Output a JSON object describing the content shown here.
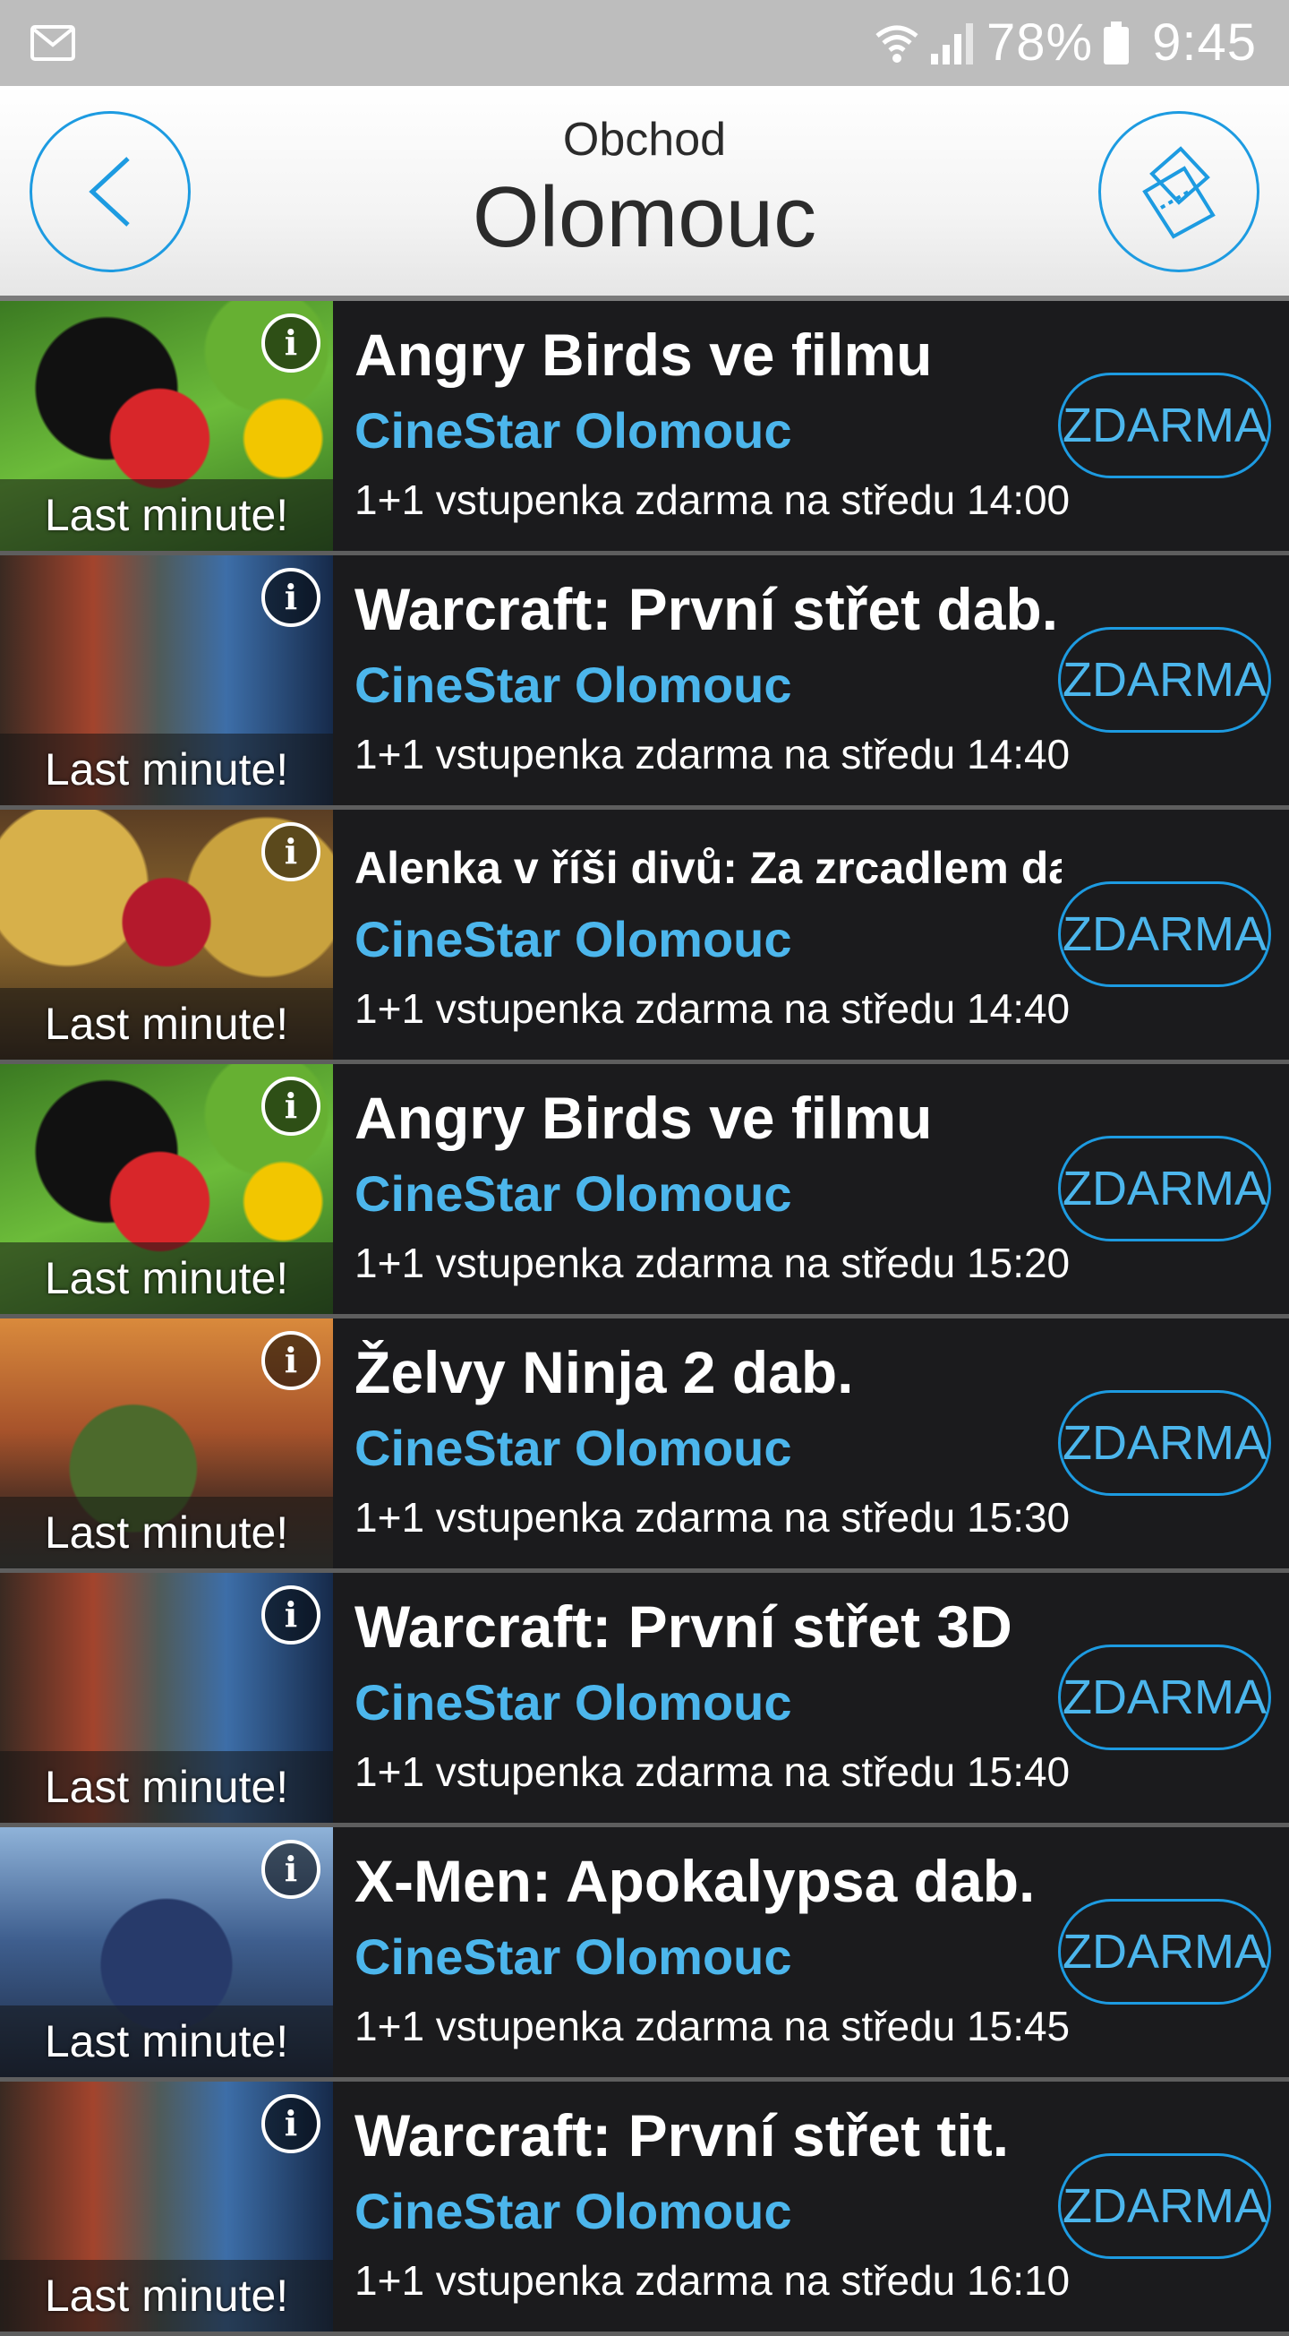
{
  "status_bar": {
    "battery": "78%",
    "time": "9:45"
  },
  "header": {
    "subtitle": "Obchod",
    "title": "Olomouc"
  },
  "items": [
    {
      "art": "angry",
      "badge": "Last minute!",
      "title": "Angry Birds ve filmu",
      "cinema": "CineStar Olomouc",
      "deal": "1+1 vstupenka zdarma na středu 14:00",
      "price": "ZDARMA",
      "info": "i"
    },
    {
      "art": "warcraft",
      "badge": "Last minute!",
      "title": "Warcraft: První střet dab.",
      "cinema": "CineStar Olomouc",
      "deal": "1+1 vstupenka zdarma na středu 14:40",
      "price": "ZDARMA",
      "info": "i"
    },
    {
      "art": "alenka",
      "badge": "Last minute!",
      "title": "Alenka v říši divů: Za zrcadlem dab.",
      "cinema": "CineStar Olomouc",
      "deal": "1+1 vstupenka zdarma na středu 14:40",
      "price": "ZDARMA",
      "info": "i"
    },
    {
      "art": "angry",
      "badge": "Last minute!",
      "title": "Angry Birds ve filmu",
      "cinema": "CineStar Olomouc",
      "deal": "1+1 vstupenka zdarma na středu 15:20",
      "price": "ZDARMA",
      "info": "i"
    },
    {
      "art": "zelvy",
      "badge": "Last minute!",
      "title": "Želvy Ninja 2 dab.",
      "cinema": "CineStar Olomouc",
      "deal": "1+1 vstupenka zdarma na středu 15:30",
      "price": "ZDARMA",
      "info": "i"
    },
    {
      "art": "warcraft",
      "badge": "Last minute!",
      "title": "Warcraft: První střet 3D",
      "cinema": "CineStar Olomouc",
      "deal": "1+1 vstupenka zdarma na středu 15:40",
      "price": "ZDARMA",
      "info": "i"
    },
    {
      "art": "xmen",
      "badge": "Last minute!",
      "title": "X-Men: Apokalypsa dab.",
      "cinema": "CineStar Olomouc",
      "deal": "1+1 vstupenka zdarma na středu 15:45",
      "price": "ZDARMA",
      "info": "i"
    },
    {
      "art": "warcraft",
      "badge": "Last minute!",
      "title": "Warcraft: První střet tit.",
      "cinema": "CineStar Olomouc",
      "deal": "1+1 vstupenka zdarma na středu 16:10",
      "price": "ZDARMA",
      "info": "i"
    }
  ]
}
